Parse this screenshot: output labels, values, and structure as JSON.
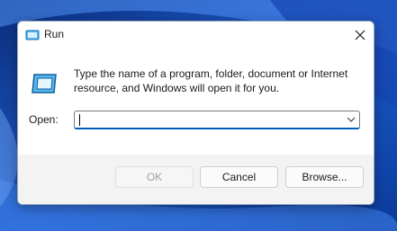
{
  "dialog": {
    "title": "Run",
    "title_icon": "run-icon",
    "close_icon": "close-icon",
    "description": "Type the name of a program, folder, document or Internet resource, and Windows will open it for you.",
    "open_label": "Open:",
    "open_value": "",
    "buttons": {
      "ok": "OK",
      "cancel": "Cancel",
      "browse": "Browse..."
    }
  },
  "colors": {
    "accent": "#005fb8",
    "dialog_background": "#f3f3f3",
    "wallpaper": "#0b3fa0"
  }
}
